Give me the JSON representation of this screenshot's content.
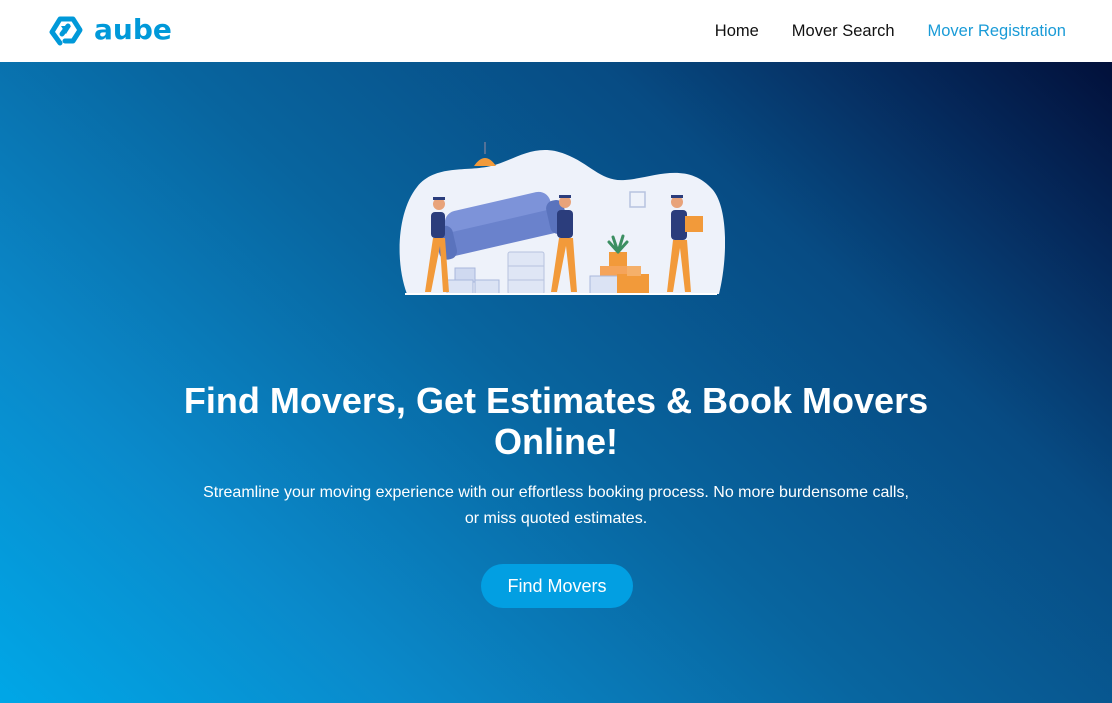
{
  "colors": {
    "brand": "#0099d9",
    "nav_active": "#1a9bd7",
    "cta": "#029fe2",
    "text_dark": "#111111"
  },
  "header": {
    "logo_text": "aube",
    "nav": [
      {
        "label": "Home",
        "active": false
      },
      {
        "label": "Mover Search",
        "active": false
      },
      {
        "label": "Mover Registration",
        "active": true
      }
    ]
  },
  "hero": {
    "illustration": "movers-carrying-furniture-illustration",
    "title": "Find Movers, Get Estimates & Book Movers Online!",
    "subtitle": "Streamline your moving experience with our effortless booking process. No more burdensome calls, or miss quoted estimates.",
    "cta_label": "Find Movers"
  }
}
